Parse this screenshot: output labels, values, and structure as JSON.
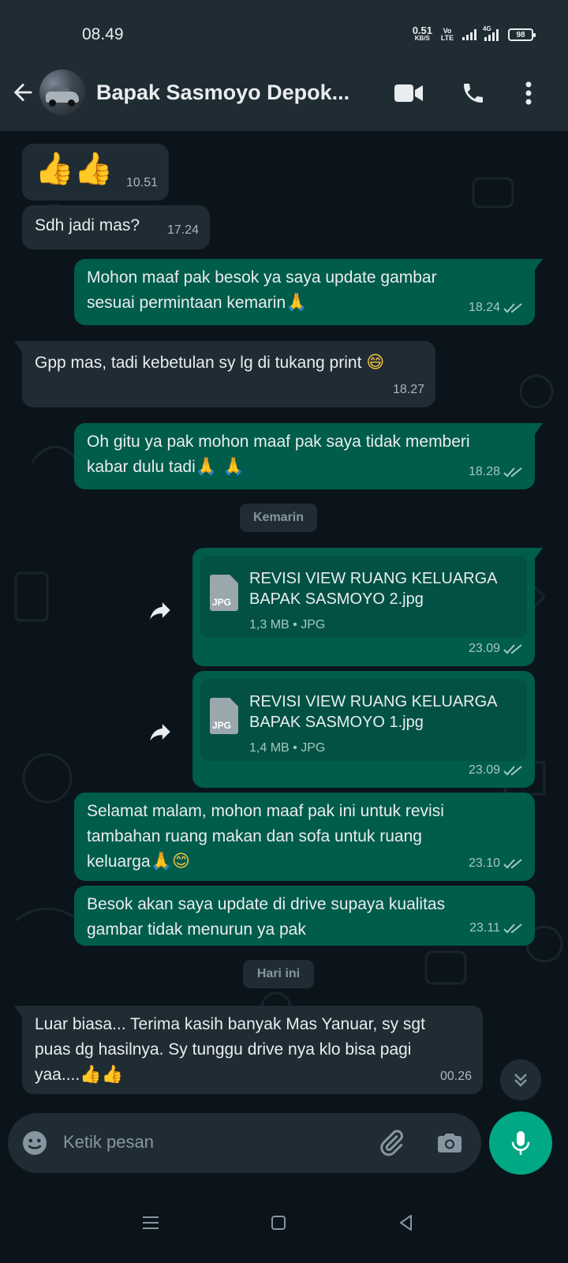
{
  "status_bar": {
    "time": "08.49",
    "speed_value": "0.51",
    "speed_unit": "KB/S",
    "volte": "Vo LTE",
    "network": "4G",
    "battery": "98"
  },
  "header": {
    "contact_name": "Bapak Sasmoyo Depok...",
    "icons": [
      "back-arrow-icon",
      "video-call-icon",
      "phone-icon",
      "more-options-icon"
    ]
  },
  "messages": [
    {
      "dir": "in",
      "emoji": "👍👍",
      "time": "10.51"
    },
    {
      "dir": "in",
      "text": "Sdh jadi mas?",
      "time": "17.24"
    },
    {
      "dir": "out",
      "lines": [
        "Mohon maaf pak besok ya saya update gambar",
        "sesuai permintaan kemarin"
      ],
      "emoji": "🙏",
      "time": "18.24",
      "status": "read"
    },
    {
      "dir": "in",
      "text": "Gpp mas, tadi kebetulan sy lg di tukang print",
      "emoji": "😄",
      "time": "18.27"
    },
    {
      "dir": "out",
      "lines": [
        "Oh gitu ya pak mohon maaf pak saya tidak memberi",
        "kabar dulu tadi"
      ],
      "emoji": "🙏 🙏",
      "time": "18.28",
      "status": "read"
    },
    {
      "dir": "out",
      "type": "document",
      "file_name_lines": [
        "REVISI VIEW RUANG KELUARGA",
        "BAPAK SASMOYO 2.jpg"
      ],
      "file_size": "1,3 MB",
      "file_type": "JPG",
      "icon_label": "JPG",
      "time": "23.09",
      "status": "read"
    },
    {
      "dir": "out",
      "type": "document",
      "file_name_lines": [
        "REVISI VIEW RUANG KELUARGA",
        "BAPAK SASMOYO 1.jpg"
      ],
      "file_size": "1,4 MB",
      "file_type": "JPG",
      "icon_label": "JPG",
      "time": "23.09",
      "status": "read"
    },
    {
      "dir": "out",
      "lines": [
        "Selamat malam, mohon maaf pak ini untuk revisi",
        "tambahan ruang makan dan sofa untuk ruang",
        "keluarga"
      ],
      "emoji": "🙏😊",
      "time": "23.10",
      "status": "read"
    },
    {
      "dir": "out",
      "lines": [
        "Besok akan saya update di drive supaya kualitas",
        "gambar tidak menurun ya pak"
      ],
      "time": "23.11",
      "status": "read"
    },
    {
      "dir": "in",
      "lines": [
        "Luar biasa... Terima kasih banyak Mas Yanuar, sy sgt",
        "puas dg hasilnya. Sy tunggu drive nya klo bisa pagi",
        "yaa...."
      ],
      "emoji": "👍👍",
      "time": "00.26"
    }
  ],
  "date_separators": {
    "yesterday": "Kemarin",
    "today": "Hari ini"
  },
  "composer": {
    "placeholder": "Ketik pesan",
    "icons": [
      "emoji-icon",
      "attach-icon",
      "camera-icon",
      "mic-icon"
    ]
  },
  "colors": {
    "chat_background": "#0b141a",
    "header_background": "#1f2c34",
    "incoming_bubble": "#1f2c34",
    "outgoing_bubble": "#005c4b",
    "accent": "#00a884"
  }
}
